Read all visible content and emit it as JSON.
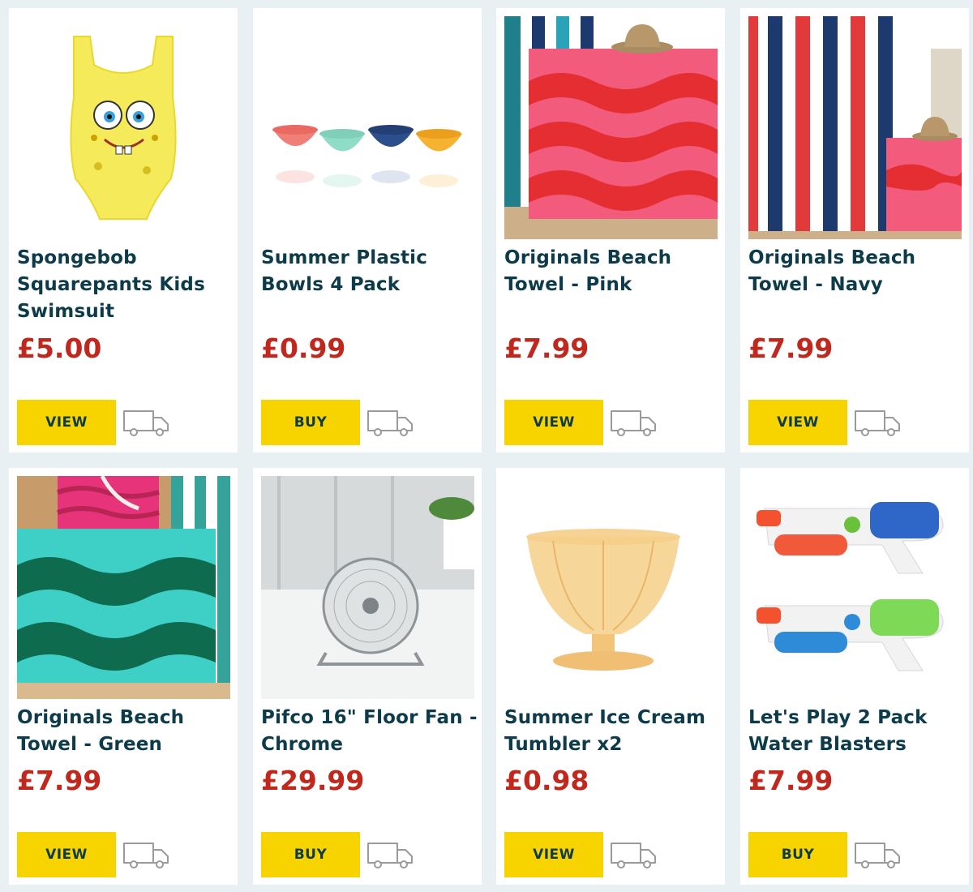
{
  "products": [
    {
      "title": "Spongebob Squarepants Kids Swimsuit",
      "price": "£5.00",
      "button": "VIEW",
      "image": "yellow-swimsuit-image"
    },
    {
      "title": "Summer Plastic Bowls 4 Pack",
      "price": "£0.99",
      "button": "BUY",
      "image": "plastic-bowls-image"
    },
    {
      "title": "Originals Beach Towel - Pink",
      "price": "£7.99",
      "button": "VIEW",
      "image": "pink-towel-image"
    },
    {
      "title": "Originals Beach Towel - Navy",
      "price": "£7.99",
      "button": "VIEW",
      "image": "navy-towel-image"
    },
    {
      "title": "Originals Beach Towel - Green",
      "price": "£7.99",
      "button": "VIEW",
      "image": "green-towel-image"
    },
    {
      "title": "Pifco 16\" Floor Fan - Chrome",
      "price": "£29.99",
      "button": "BUY",
      "image": "floor-fan-image"
    },
    {
      "title": "Summer Ice Cream Tumbler x2",
      "price": "£0.98",
      "button": "VIEW",
      "image": "ice-cream-tumbler-image"
    },
    {
      "title": "Let's Play 2 Pack Water Blasters",
      "price": "£7.99",
      "button": "BUY",
      "image": "water-blasters-image"
    }
  ],
  "icons": {
    "delivery": "delivery-van-icon"
  },
  "colors": {
    "background": "#e8f0f4",
    "title": "#0d3b4a",
    "price": "#c0281d",
    "button": "#f7d300"
  }
}
